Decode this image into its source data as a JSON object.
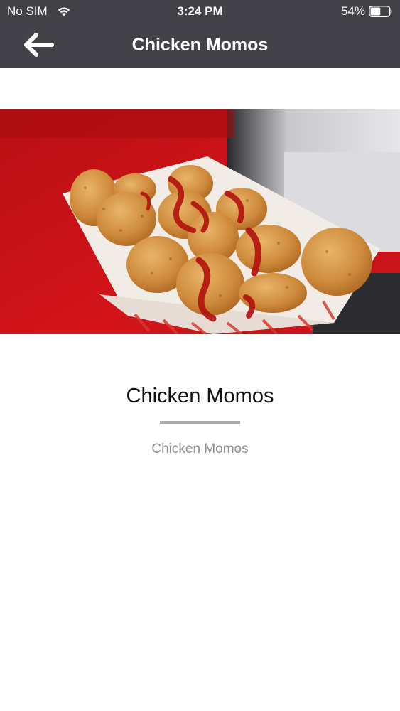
{
  "status": {
    "carrier": "No SIM",
    "time": "3:24 PM",
    "battery": "54%",
    "battery_level": 0.54
  },
  "nav": {
    "title": "Chicken Momos",
    "back_icon": "arrow-left-icon"
  },
  "hero": {
    "image_name": "food-photo"
  },
  "item": {
    "title": "Chicken Momos",
    "description": "Chicken Momos"
  },
  "colors": {
    "header_bg": "#434249",
    "divider": "#a9a9ad",
    "description_text": "#8e8e93"
  }
}
